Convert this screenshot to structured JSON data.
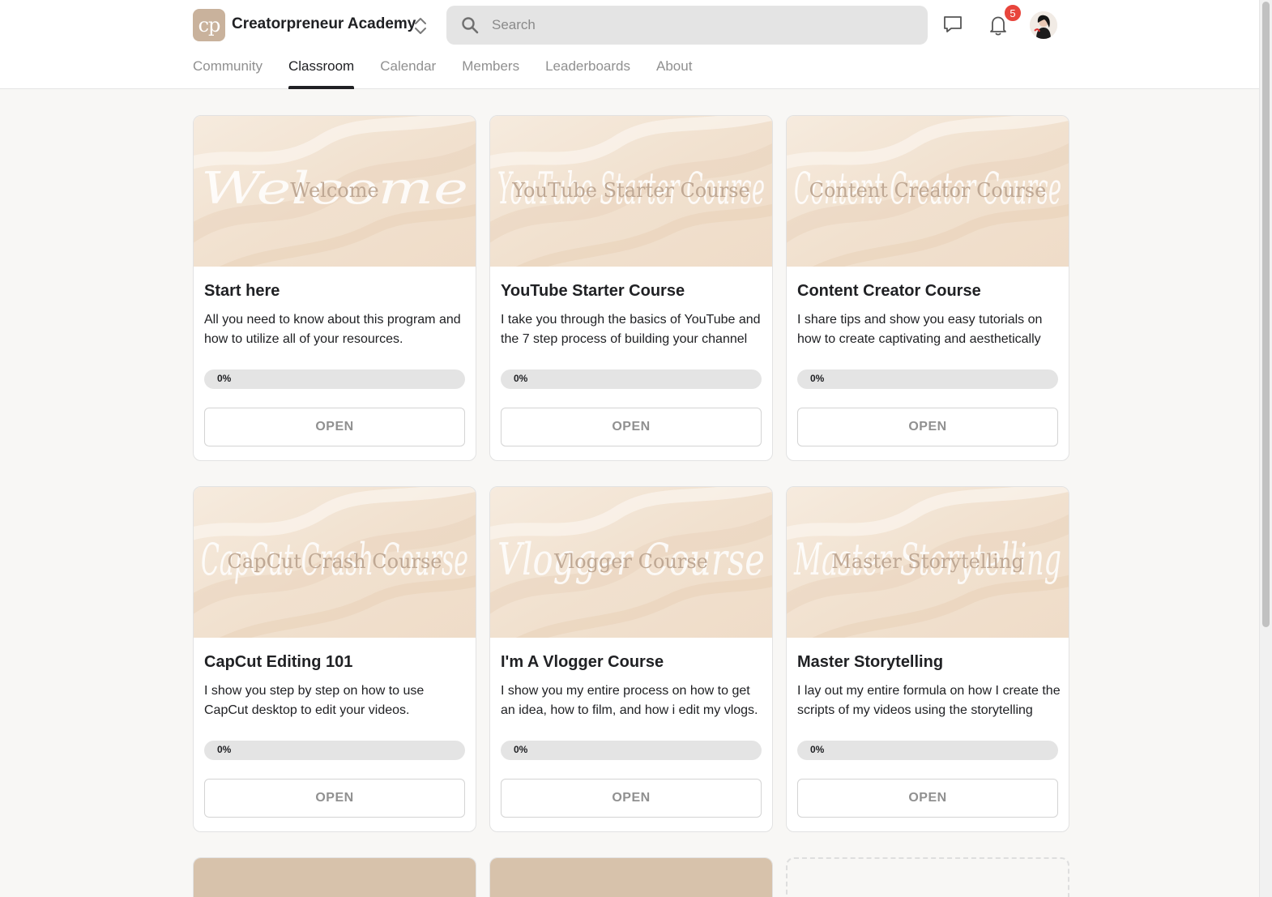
{
  "header": {
    "logo_text": "cp",
    "community_name": "Creatorpreneur Academy",
    "search_placeholder": "Search",
    "notification_count": "5",
    "icons": {
      "switcher": "chevron-up-down-icon",
      "search": "search-icon",
      "chat": "chat-icon",
      "notifications": "bell-icon"
    }
  },
  "tabs": [
    {
      "label": "Community",
      "active": false
    },
    {
      "label": "Classroom",
      "active": true
    },
    {
      "label": "Calendar",
      "active": false
    },
    {
      "label": "Members",
      "active": false
    },
    {
      "label": "Leaderboards",
      "active": false
    },
    {
      "label": "About",
      "active": false
    }
  ],
  "courses": [
    {
      "cover_script": "Welcome",
      "cover_caption": "Welcome",
      "title": "Start here",
      "description": "All you need to know about this program and how to utilize all of your resources.",
      "progress_label": "0%",
      "progress": 0,
      "button": "OPEN"
    },
    {
      "cover_script": "YouTube Starter Course",
      "cover_caption": "YouTube Starter Course",
      "title": "YouTube Starter Course",
      "description": "I take you through the basics of YouTube and the 7 step process of building your channel",
      "progress_label": "0%",
      "progress": 0,
      "button": "OPEN"
    },
    {
      "cover_script": "Content Creator Course",
      "cover_caption": "Content Creator Course",
      "title": "Content Creator Course",
      "description": "I share tips and show you easy tutorials on how to create captivating and aesthetically",
      "progress_label": "0%",
      "progress": 0,
      "button": "OPEN"
    },
    {
      "cover_script": "CapCut Crash Course",
      "cover_caption": "CapCut Crash Course",
      "title": "CapCut Editing 101",
      "description": "I show you step by step on how to use CapCut desktop to edit your videos.",
      "progress_label": "0%",
      "progress": 0,
      "button": "OPEN"
    },
    {
      "cover_script": "Vlogger Course",
      "cover_caption": "Vlogger Course",
      "title": "I'm A Vlogger Course",
      "description": "I show you my entire process on how to get an idea, how to film, and how i edit my vlogs.",
      "progress_label": "0%",
      "progress": 0,
      "button": "OPEN"
    },
    {
      "cover_script": "Master Storytelling",
      "cover_caption": "Master Storytelling",
      "title": "Master Storytelling",
      "description": "I lay out my entire formula on how I create the scripts of my videos using the storytelling",
      "progress_label": "0%",
      "progress": 0,
      "button": "OPEN"
    }
  ],
  "colors": {
    "brand": "#c9b29c",
    "badge": "#e8453c",
    "cover_base": "#f3e6d8",
    "active_tab": "#202124"
  }
}
